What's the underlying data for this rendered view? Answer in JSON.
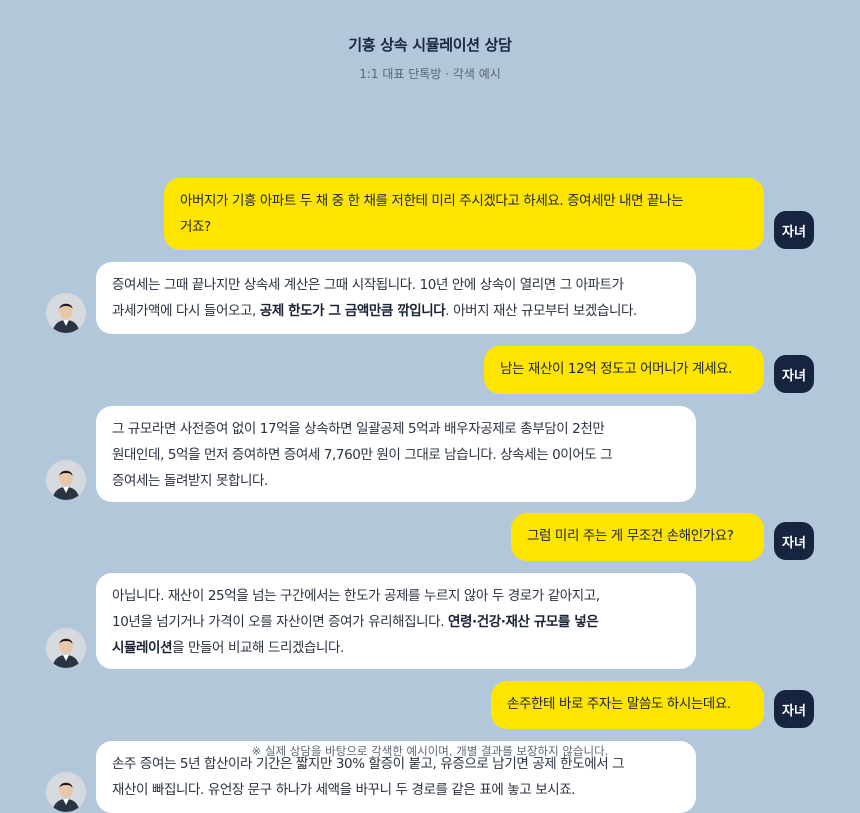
{
  "header": {
    "title": "기흥 상속 시뮬레이션 상담",
    "subtitle": "1:1 대표 단톡방 · 각색 예시"
  },
  "avatars": {
    "me_label": "자녀",
    "other_icon": "advisor-photo-icon"
  },
  "messages": [
    {
      "role": "me",
      "line1": "아버지가 기흥 아파트 두 채 중 한 채를 저한테 미리 주시겠다고 하세요. 증여세만 내면 끝나는",
      "line2": "거죠?"
    },
    {
      "role": "other",
      "line1": "증여세는 그때 끝나지만 상속세 계산은 그때 시작됩니다. 10년 안에 상속이 열리면 그 아파트가",
      "line2_a": "과세가액에 다시 들어오고, ",
      "line2_b": "공제 한도가 그 금액만큼 깎입니다",
      "line2_c": ". 아버지 재산 규모부터 보겠습니다."
    },
    {
      "role": "me",
      "text": "남는 재산이 12억 정도고 어머니가 계세요."
    },
    {
      "role": "other",
      "line1": "그 규모라면 사전증여 없이 17억을 상속하면 일괄공제 5억과 배우자공제로 총부담이 2천만",
      "line2": "원대인데, 5억을 먼저 증여하면 증여세 7,760만 원이 그대로 남습니다. 상속세는 0이어도 그",
      "line3": "증여세는 돌려받지 못합니다."
    },
    {
      "role": "me",
      "text": "그럼 미리 주는 게 무조건 손해인가요?"
    },
    {
      "role": "other",
      "line1": "아닙니다. 재산이 25억을 넘는 구간에서는 한도가 공제를 누르지 않아 두 경로가 같아지고,",
      "line2_a": "10년을 넘기거나 가격이 오를 자산이면 증여가 유리해집니다. ",
      "line2_b": "연령·건강·재산 규모를 넣은",
      "line3_a": "시뮬레이션",
      "line3_b": "을 만들어 비교해 드리겠습니다."
    },
    {
      "role": "me",
      "text": "손주한테 바로 주자는 말씀도 하시는데요."
    },
    {
      "role": "other",
      "line1": "손주 증여는 5년 합산이라 기간은 짧지만 30% 할증이 붙고, 유증으로 남기면 공제 한도에서 그",
      "line2": "재산이 빠집니다. 유언장 문구 하나가 세액을 바꾸니 두 경로를 같은 표에 놓고 보시죠."
    }
  ],
  "footnote": "※ 실제 상담을 바탕으로 각색한 예시이며, 개별 결과를 보장하지 않습니다.",
  "colors": {
    "background": "#b2c7da",
    "me_bubble": "#fee500",
    "other_bubble": "#ffffff",
    "me_avatar": "#162440"
  }
}
